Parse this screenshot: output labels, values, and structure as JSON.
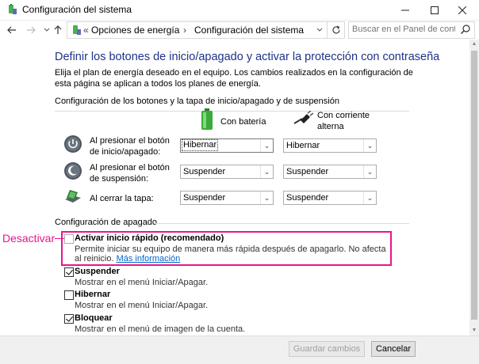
{
  "window": {
    "title": "Configuración del sistema"
  },
  "nav": {
    "breadcrumb_sep": "«",
    "crumb1": "Opciones de energía",
    "crumb_arrow": "›",
    "crumb2": "Configuración del sistema",
    "search_placeholder": "Buscar en el Panel de control"
  },
  "main": {
    "heading": "Definir los botones de inicio/apagado y activar la protección con contraseña",
    "intro": "Elija el plan de energía deseado en el equipo. Los cambios realizados en la configuración de esta página se aplican a todos los planes de energía.",
    "buttons_section": "Configuración de los botones y la tapa de inicio/apagado y de suspensión",
    "col_battery": "Con batería",
    "col_ac": "Con corriente alterna",
    "rows": [
      {
        "label": "Al presionar el botón de inicio/apagado:",
        "battery": "Hibernar",
        "ac": "Hibernar"
      },
      {
        "label": "Al presionar el botón de suspensión:",
        "battery": "Suspender",
        "ac": "Suspender"
      },
      {
        "label": "Al cerrar la tapa:",
        "battery": "Suspender",
        "ac": "Suspender"
      }
    ],
    "shutdown_section": "Configuración de apagado",
    "options": [
      {
        "label": "Activar inicio rápido (recomendado)",
        "desc": "Permite iniciar su equipo de manera más rápida después de apagarlo. No afecta al reinicio.",
        "link": "Más información",
        "checked": false
      },
      {
        "label": "Suspender",
        "desc": "Mostrar en el menú Iniciar/Apagar.",
        "checked": true
      },
      {
        "label": "Hibernar",
        "desc": "Mostrar en el menú Iniciar/Apagar.",
        "checked": false
      },
      {
        "label": "Bloquear",
        "desc": "Mostrar en el menú de imagen de la cuenta.",
        "checked": true
      }
    ]
  },
  "annotation": {
    "callout": "Desactivar",
    "color": "#e8168c"
  },
  "footer": {
    "save": "Guardar cambios",
    "cancel": "Cancelar"
  },
  "colors": {
    "heading": "#1e3287",
    "link": "#0066cc",
    "battery_green": "#3caa3c"
  }
}
